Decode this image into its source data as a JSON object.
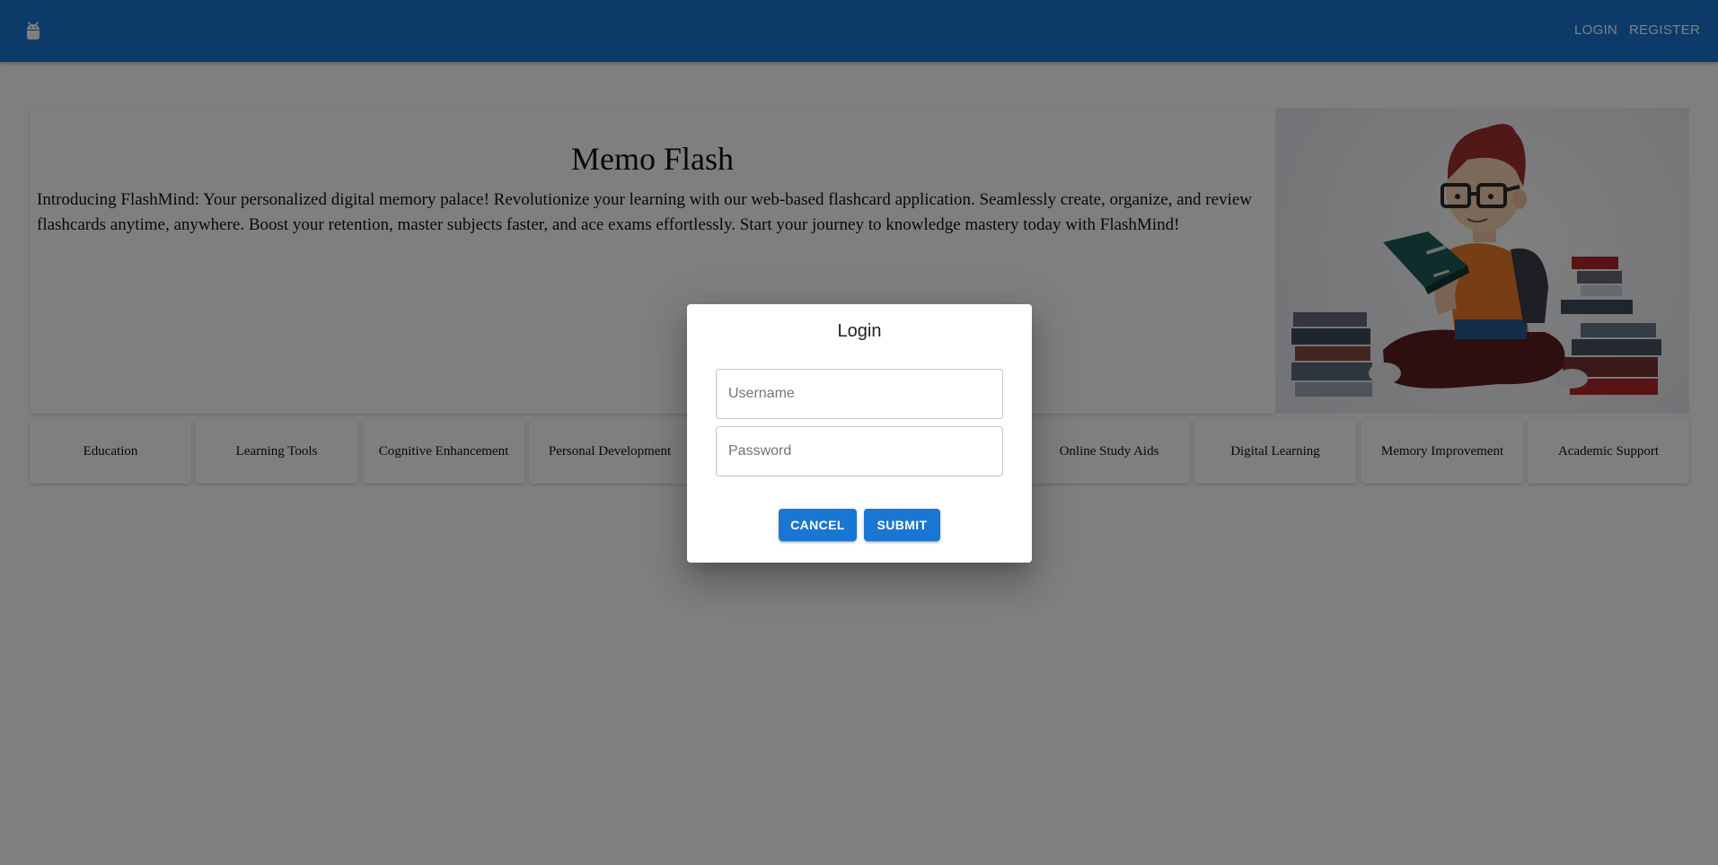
{
  "appbar": {
    "logo_icon": "android-icon",
    "nav": {
      "login_label": "LOGIN",
      "register_label": "REGISTER"
    },
    "color": "#1976d2"
  },
  "hero": {
    "title": "Memo Flash",
    "description": "Introducing FlashMind: Your personalized digital memory palace! Revolutionize your learning with our web-based flashcard application. Seamlessly create, organize, and review flashcards anytime, anywhere. Boost your retention, master subjects faster, and ace exams effortlessly. Start your journey to knowledge mastery today with FlashMind!",
    "illustration": "student-reading-on-books-illustration"
  },
  "tags": [
    "Education",
    "Learning Tools",
    "Cognitive Enhancement",
    "Personal Development",
    "",
    "",
    "Online Study Aids",
    "Digital Learning",
    "Memory Improvement",
    "Academic Support"
  ],
  "login_dialog": {
    "title": "Login",
    "username": {
      "value": "",
      "placeholder": "Username"
    },
    "password": {
      "value": "",
      "placeholder": "Password"
    },
    "cancel_label": "CANCEL",
    "submit_label": "SUBMIT"
  }
}
